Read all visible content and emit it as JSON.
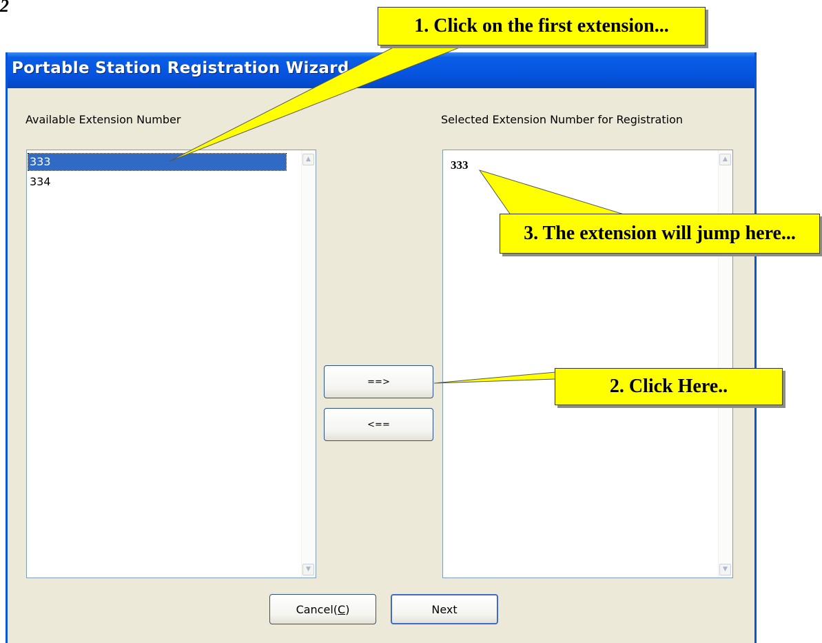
{
  "step_label": "2",
  "window": {
    "title": "Portable Station Registration Wizard"
  },
  "available": {
    "label": "Available Extension Number",
    "items": [
      "333",
      "334"
    ],
    "selected_item": "333"
  },
  "selected": {
    "label": "Selected Extension Number for Registration",
    "items": [
      "333"
    ]
  },
  "buttons": {
    "add": "==>",
    "remove": "<==",
    "cancel": "Cancel(C)",
    "next": "Next"
  },
  "callouts": {
    "step1": "1. Click on the first extension...",
    "step2": "2. Click Here..",
    "step3": "3. The extension will jump here..."
  },
  "colors": {
    "titlebar": "#0654e0",
    "dialog_bg": "#ece9d8",
    "selection": "#316ac5",
    "callout": "#ffff00"
  }
}
